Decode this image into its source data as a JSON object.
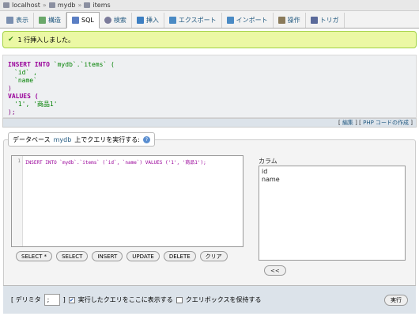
{
  "breadcrumb": {
    "server": "localhost",
    "database": "mydb",
    "table": "items"
  },
  "tabs": [
    {
      "label": "表示",
      "icon": "table-icon",
      "color": "#7a8fb0"
    },
    {
      "label": "構造",
      "icon": "structure-icon",
      "color": "#6aa86a"
    },
    {
      "label": "SQL",
      "icon": "sql-icon",
      "color": "#5b7fc4",
      "active": true
    },
    {
      "label": "検索",
      "icon": "search-icon",
      "color": "#7b7b9b"
    },
    {
      "label": "挿入",
      "icon": "insert-icon",
      "color": "#3d7fc2"
    },
    {
      "label": "エクスポート",
      "icon": "export-icon",
      "color": "#4a8ac4"
    },
    {
      "label": "インポート",
      "icon": "import-icon",
      "color": "#4a8ac4"
    },
    {
      "label": "操作",
      "icon": "wrench-icon",
      "color": "#8a7a5a"
    },
    {
      "label": "トリガ",
      "icon": "trigger-icon",
      "color": "#5a6a9a"
    }
  ],
  "message": {
    "text": "1 行挿入しました。",
    "icon": "checkmark-icon"
  },
  "sql_display": {
    "line1_kw": "INSERT INTO",
    "line1_rest": " `mydb`.`items` (",
    "line2": "`id` ,",
    "line3": "`name`",
    "line4": ")",
    "line5_kw": "VALUES (",
    "line6": "'1', '商品1'",
    "line7": ");"
  },
  "edit_links": {
    "open": "[",
    "edit": "編集",
    "mid": "] [",
    "php": "PHP コードの作成",
    "close": "]"
  },
  "query_panel": {
    "title_prefix": "データベース",
    "title_db": "mydb",
    "title_suffix": "上でクエリを実行する:",
    "help_icon": "help-icon",
    "line_number": "1",
    "query": "INSERT INTO `mydb`.`items` (`id`, `name`) VALUES ('1', '商品1');",
    "buttons": [
      "SELECT *",
      "SELECT",
      "INSERT",
      "UPDATE",
      "DELETE",
      "クリア"
    ],
    "columns_label": "カラム",
    "columns": [
      "id",
      "name"
    ],
    "insert_column_button": "<<"
  },
  "bottom": {
    "delimiter_label_open": "[ デリミタ",
    "delimiter_value": ";",
    "delimiter_label_close": "]",
    "show_query_label": "実行したクエリをここに表示する",
    "show_query_checked": true,
    "keep_box_label": "クエリボックスを保持する",
    "keep_box_checked": false,
    "go_button": "実行"
  }
}
